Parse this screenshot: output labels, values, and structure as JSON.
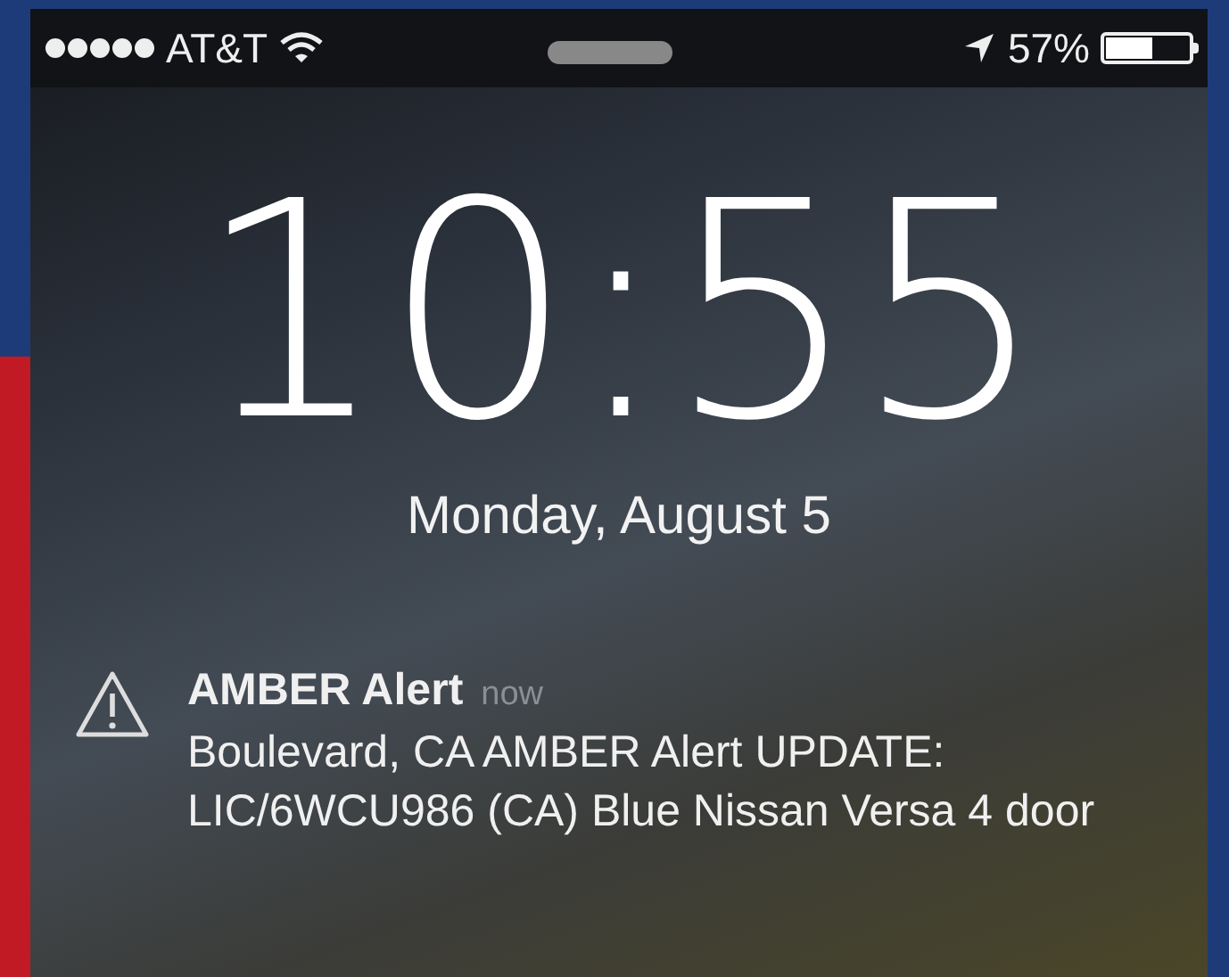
{
  "status_bar": {
    "carrier": "AT&T",
    "battery_percent": "57%",
    "battery": {
      "level": 0.57
    }
  },
  "lock_screen": {
    "time": "10:55",
    "date": "Monday, August 5"
  },
  "notification": {
    "title": "AMBER Alert",
    "time": "now",
    "body": "Boulevard, CA AMBER Alert UPDATE: LIC/6WCU986 (CA) Blue Nissan Versa 4 door"
  }
}
